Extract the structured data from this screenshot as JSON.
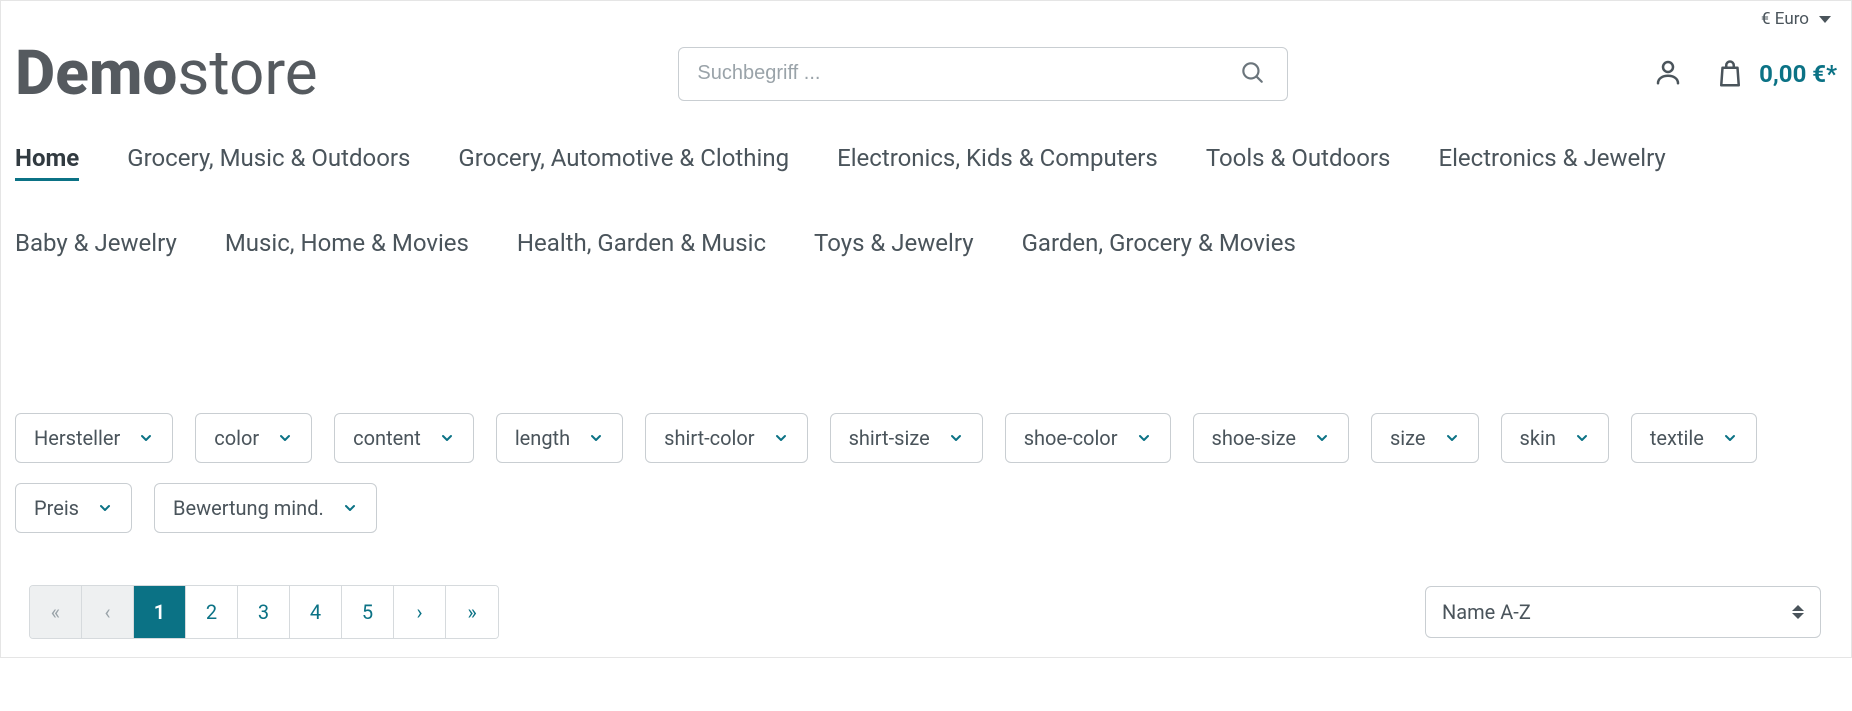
{
  "topbar": {
    "currency_label": "€ Euro"
  },
  "logo": {
    "part1": "Demo",
    "part2": "store"
  },
  "search": {
    "placeholder": "Suchbegriff ..."
  },
  "cart": {
    "total": "0,00 €*"
  },
  "nav": {
    "items": [
      {
        "label": "Home",
        "active": true
      },
      {
        "label": "Grocery, Music & Outdoors"
      },
      {
        "label": "Grocery, Automotive & Clothing"
      },
      {
        "label": "Electronics, Kids & Computers"
      },
      {
        "label": "Tools & Outdoors"
      },
      {
        "label": "Electronics & Jewelry"
      },
      {
        "label": "Baby & Jewelry"
      },
      {
        "label": "Music, Home & Movies"
      },
      {
        "label": "Health, Garden & Music"
      },
      {
        "label": "Toys & Jewelry"
      },
      {
        "label": "Garden, Grocery & Movies"
      }
    ]
  },
  "filters": {
    "items": [
      {
        "label": "Hersteller"
      },
      {
        "label": "color"
      },
      {
        "label": "content"
      },
      {
        "label": "length"
      },
      {
        "label": "shirt-color"
      },
      {
        "label": "shirt-size"
      },
      {
        "label": "shoe-color"
      },
      {
        "label": "shoe-size"
      },
      {
        "label": "size"
      },
      {
        "label": "skin"
      },
      {
        "label": "textile"
      },
      {
        "label": "Preis"
      },
      {
        "label": "Bewertung mind."
      }
    ]
  },
  "pagination": {
    "first": "«",
    "prev": "‹",
    "pages": [
      "1",
      "2",
      "3",
      "4",
      "5"
    ],
    "current": "1",
    "next": "›",
    "last": "»"
  },
  "sort": {
    "selected": "Name A-Z"
  }
}
